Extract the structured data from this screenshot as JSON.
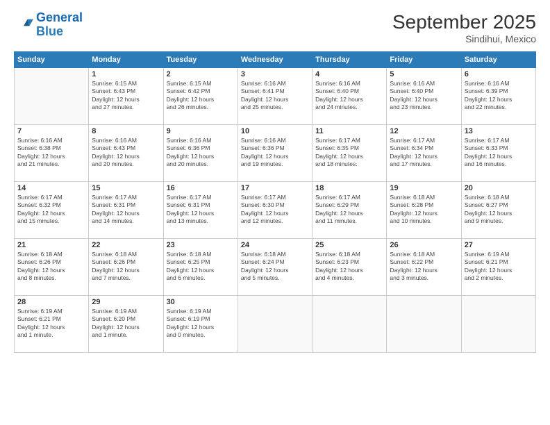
{
  "logo": {
    "line1": "General",
    "line2": "Blue"
  },
  "title": {
    "month_year": "September 2025",
    "location": "Sindihui, Mexico"
  },
  "days_of_week": [
    "Sunday",
    "Monday",
    "Tuesday",
    "Wednesday",
    "Thursday",
    "Friday",
    "Saturday"
  ],
  "weeks": [
    [
      {
        "day": "",
        "info": ""
      },
      {
        "day": "1",
        "info": "Sunrise: 6:15 AM\nSunset: 6:43 PM\nDaylight: 12 hours\nand 27 minutes."
      },
      {
        "day": "2",
        "info": "Sunrise: 6:15 AM\nSunset: 6:42 PM\nDaylight: 12 hours\nand 26 minutes."
      },
      {
        "day": "3",
        "info": "Sunrise: 6:16 AM\nSunset: 6:41 PM\nDaylight: 12 hours\nand 25 minutes."
      },
      {
        "day": "4",
        "info": "Sunrise: 6:16 AM\nSunset: 6:40 PM\nDaylight: 12 hours\nand 24 minutes."
      },
      {
        "day": "5",
        "info": "Sunrise: 6:16 AM\nSunset: 6:40 PM\nDaylight: 12 hours\nand 23 minutes."
      },
      {
        "day": "6",
        "info": "Sunrise: 6:16 AM\nSunset: 6:39 PM\nDaylight: 12 hours\nand 22 minutes."
      }
    ],
    [
      {
        "day": "7",
        "info": "Sunrise: 6:16 AM\nSunset: 6:38 PM\nDaylight: 12 hours\nand 21 minutes."
      },
      {
        "day": "8",
        "info": "Sunrise: 6:16 AM\nSunset: 6:43 PM\nDaylight: 12 hours\nand 20 minutes."
      },
      {
        "day": "9",
        "info": "Sunrise: 6:16 AM\nSunset: 6:36 PM\nDaylight: 12 hours\nand 20 minutes."
      },
      {
        "day": "10",
        "info": "Sunrise: 6:16 AM\nSunset: 6:36 PM\nDaylight: 12 hours\nand 19 minutes."
      },
      {
        "day": "11",
        "info": "Sunrise: 6:17 AM\nSunset: 6:35 PM\nDaylight: 12 hours\nand 18 minutes."
      },
      {
        "day": "12",
        "info": "Sunrise: 6:17 AM\nSunset: 6:34 PM\nDaylight: 12 hours\nand 17 minutes."
      },
      {
        "day": "13",
        "info": "Sunrise: 6:17 AM\nSunset: 6:33 PM\nDaylight: 12 hours\nand 16 minutes."
      }
    ],
    [
      {
        "day": "14",
        "info": "Sunrise: 6:17 AM\nSunset: 6:32 PM\nDaylight: 12 hours\nand 15 minutes."
      },
      {
        "day": "15",
        "info": "Sunrise: 6:17 AM\nSunset: 6:31 PM\nDaylight: 12 hours\nand 14 minutes."
      },
      {
        "day": "16",
        "info": "Sunrise: 6:17 AM\nSunset: 6:31 PM\nDaylight: 12 hours\nand 13 minutes."
      },
      {
        "day": "17",
        "info": "Sunrise: 6:17 AM\nSunset: 6:30 PM\nDaylight: 12 hours\nand 12 minutes."
      },
      {
        "day": "18",
        "info": "Sunrise: 6:17 AM\nSunset: 6:29 PM\nDaylight: 12 hours\nand 11 minutes."
      },
      {
        "day": "19",
        "info": "Sunrise: 6:18 AM\nSunset: 6:28 PM\nDaylight: 12 hours\nand 10 minutes."
      },
      {
        "day": "20",
        "info": "Sunrise: 6:18 AM\nSunset: 6:27 PM\nDaylight: 12 hours\nand 9 minutes."
      }
    ],
    [
      {
        "day": "21",
        "info": "Sunrise: 6:18 AM\nSunset: 6:26 PM\nDaylight: 12 hours\nand 8 minutes."
      },
      {
        "day": "22",
        "info": "Sunrise: 6:18 AM\nSunset: 6:26 PM\nDaylight: 12 hours\nand 7 minutes."
      },
      {
        "day": "23",
        "info": "Sunrise: 6:18 AM\nSunset: 6:25 PM\nDaylight: 12 hours\nand 6 minutes."
      },
      {
        "day": "24",
        "info": "Sunrise: 6:18 AM\nSunset: 6:24 PM\nDaylight: 12 hours\nand 5 minutes."
      },
      {
        "day": "25",
        "info": "Sunrise: 6:18 AM\nSunset: 6:23 PM\nDaylight: 12 hours\nand 4 minutes."
      },
      {
        "day": "26",
        "info": "Sunrise: 6:18 AM\nSunset: 6:22 PM\nDaylight: 12 hours\nand 3 minutes."
      },
      {
        "day": "27",
        "info": "Sunrise: 6:19 AM\nSunset: 6:21 PM\nDaylight: 12 hours\nand 2 minutes."
      }
    ],
    [
      {
        "day": "28",
        "info": "Sunrise: 6:19 AM\nSunset: 6:21 PM\nDaylight: 12 hours\nand 1 minute."
      },
      {
        "day": "29",
        "info": "Sunrise: 6:19 AM\nSunset: 6:20 PM\nDaylight: 12 hours\nand 1 minute."
      },
      {
        "day": "30",
        "info": "Sunrise: 6:19 AM\nSunset: 6:19 PM\nDaylight: 12 hours\nand 0 minutes."
      },
      {
        "day": "",
        "info": ""
      },
      {
        "day": "",
        "info": ""
      },
      {
        "day": "",
        "info": ""
      },
      {
        "day": "",
        "info": ""
      }
    ]
  ]
}
